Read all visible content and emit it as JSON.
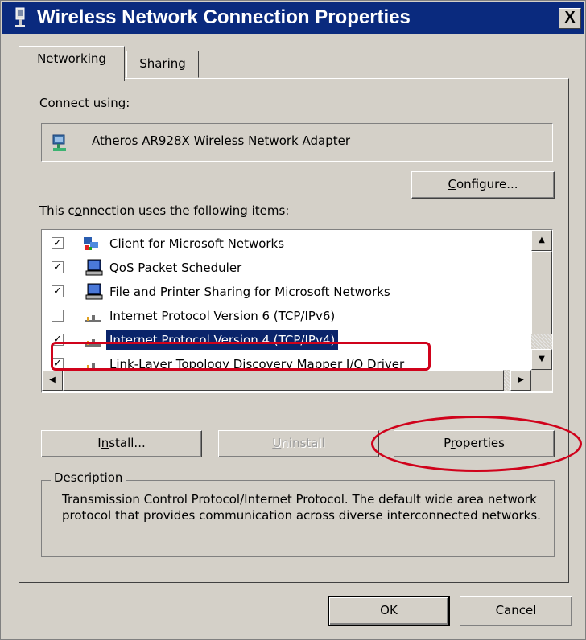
{
  "window": {
    "title": "Wireless Network Connection Properties",
    "close_symbol": "X"
  },
  "tabs": [
    {
      "label": "Networking",
      "selected": true
    },
    {
      "label": "Sharing",
      "selected": false
    }
  ],
  "connect_using": {
    "label": "Connect using:",
    "adapter": "Atheros AR928X Wireless Network Adapter",
    "adapter_icon": "network-adapter-icon",
    "configure_label_u": "C",
    "configure_label_rest": "onfigure..."
  },
  "items_section": {
    "label_pre": "This c",
    "label_u": "o",
    "label_post": "nnection uses the following items:"
  },
  "items": [
    {
      "label": "Client for Microsoft Networks",
      "checked": true,
      "icon": "client-network-icon"
    },
    {
      "label": "QoS Packet Scheduler",
      "checked": true,
      "icon": "computer-icon"
    },
    {
      "label": "File and Printer Sharing for Microsoft Networks",
      "checked": true,
      "icon": "computer-icon"
    },
    {
      "label": "Internet Protocol Version 6 (TCP/IPv6)",
      "checked": false,
      "icon": "protocol-icon"
    },
    {
      "label": "Internet Protocol Version 4 (TCP/IPv4)",
      "checked": true,
      "icon": "protocol-icon",
      "selected": true
    },
    {
      "label": "Link-Layer Topology Discovery Mapper I/O Driver",
      "checked": true,
      "icon": "protocol-icon"
    }
  ],
  "buttons": {
    "install_u": "n",
    "install_pre": "I",
    "install_post": "stall...",
    "uninstall_u": "U",
    "uninstall_post": "ninstall",
    "properties_pre": "P",
    "properties_u": "r",
    "properties_post": "operties",
    "ok": "OK",
    "cancel": "Cancel"
  },
  "description": {
    "title": "Description",
    "text": "Transmission Control Protocol/Internet Protocol. The default wide area network protocol that provides communication across diverse interconnected networks."
  },
  "colors": {
    "title_bar": "#0a2a7e",
    "face": "#d4d0c8",
    "selection": "#0a246a",
    "annotation": "#d0021b"
  }
}
